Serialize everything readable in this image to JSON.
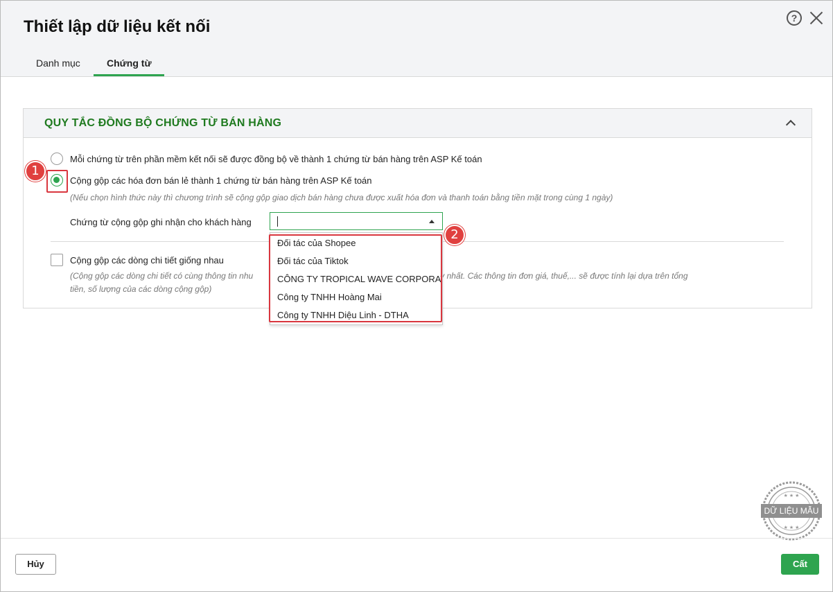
{
  "dialog": {
    "title": "Thiết lập dữ liệu kết nối",
    "help_icon": "help-circle-icon",
    "close_icon": "close-icon"
  },
  "tabs": [
    {
      "label": "Danh mục",
      "active": false
    },
    {
      "label": "Chứng từ",
      "active": true
    }
  ],
  "section": {
    "title": "QUY TẮC ĐỒNG BỘ CHỨNG TỪ BÁN HÀNG",
    "collapse_icon": "chevron-up-icon",
    "options": [
      {
        "label": "Mỗi chứng từ trên phần mềm kết nối sẽ được đồng bộ về thành 1 chứng từ bán hàng trên ASP Kế toán",
        "selected": false
      },
      {
        "label": "Cộng gộp các hóa đơn bán lẻ thành 1 chứng từ bán hàng trên ASP Kế toán",
        "selected": true,
        "note": "(Nếu chọn hình thức này thì chương trình sẽ cộng gộp giao dịch bán hàng chưa được xuất hóa đơn và thanh toán bằng tiền mặt trong cùng 1 ngày)"
      }
    ],
    "customer_field": {
      "label": "Chứng từ cộng gộp ghi nhận cho khách hàng",
      "value": "",
      "options": [
        "Đối tác của Shopee",
        "Đối tác của Tiktok",
        "CÔNG TY TROPICAL WAVE CORPORATIO",
        "Công ty TNHH Hoàng Mai",
        "Công ty TNHH Diệu Linh - DTHA"
      ]
    },
    "merge_details": {
      "label": "Cộng gộp các dòng chi tiết giống nhau",
      "checked": false,
      "note_line1_left": "(Cộng gộp các dòng chi tiết có cùng thông tin nhu",
      "note_line1_right": "thành một dòng duy nhất. Các thông tin đơn giá, thuế,... sẽ được tính lại dựa trên tổng",
      "note_line2": "tiền, số lượng của các dòng cộng gộp)"
    }
  },
  "annotations": {
    "marker1": "1",
    "marker2": "2"
  },
  "watermark": {
    "text": "DỮ LIỆU MẪU"
  },
  "footer": {
    "cancel_label": "Hủy",
    "save_label": "Cất"
  },
  "colors": {
    "accent": "#2ea44f",
    "section_title": "#1f7a1f",
    "highlight": "#d9363e"
  }
}
